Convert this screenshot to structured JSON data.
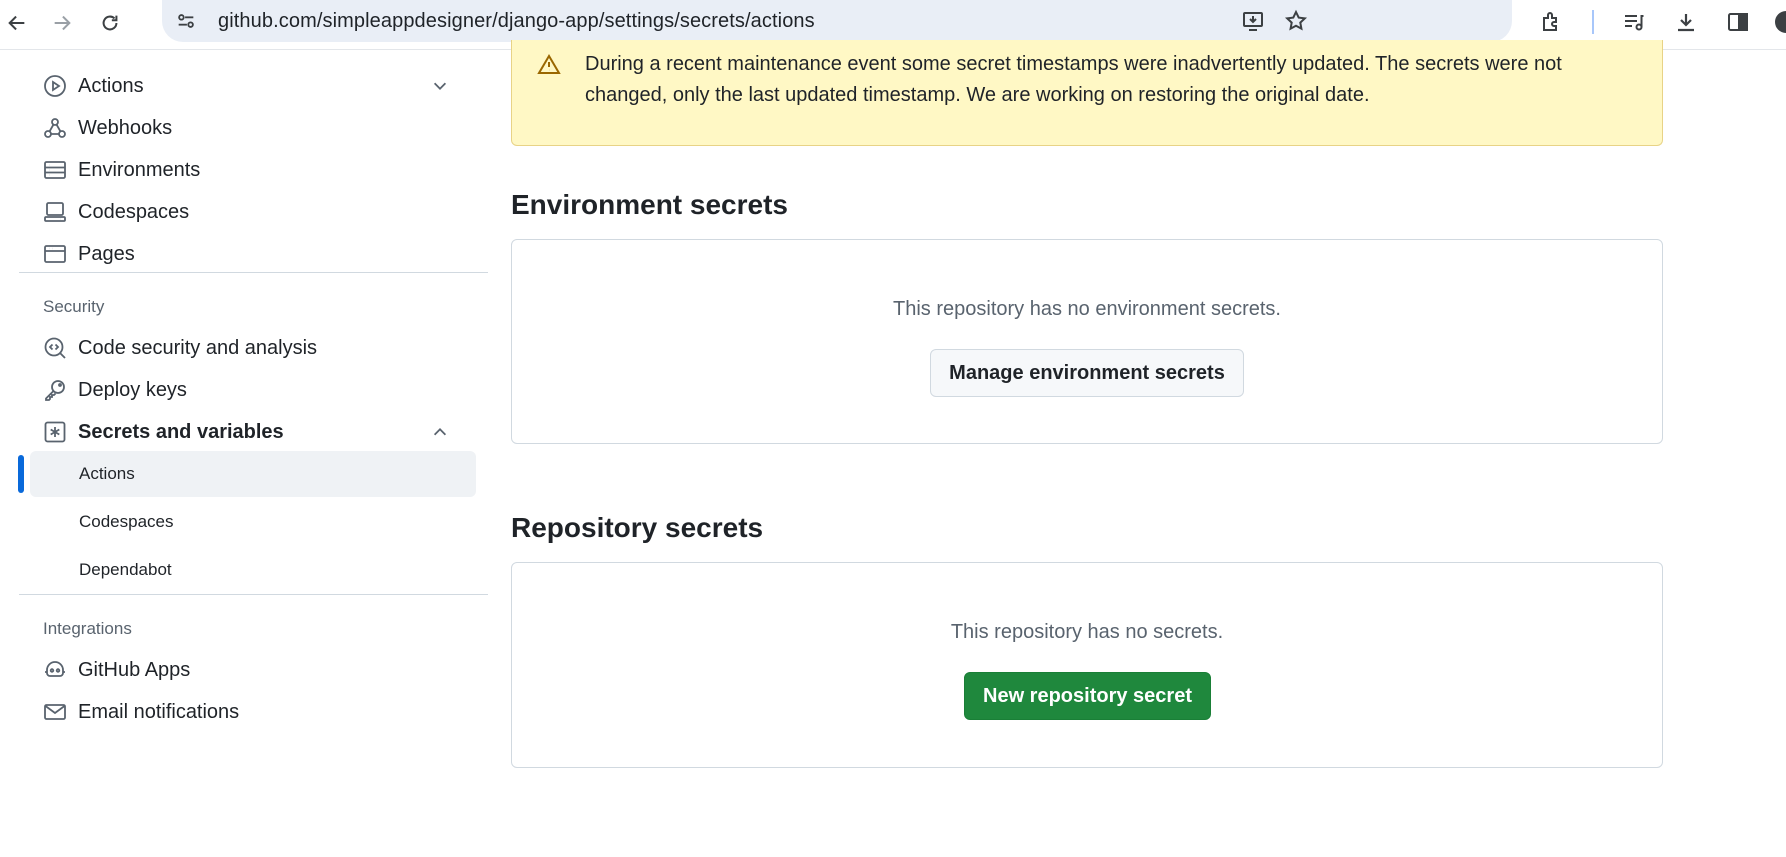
{
  "browser": {
    "url": "github.com/simpleappdesigner/django-app/settings/secrets/actions"
  },
  "sidebar": {
    "items": [
      {
        "label": "Actions",
        "icon": "play-icon",
        "expandable": true
      },
      {
        "label": "Webhooks",
        "icon": "webhook-icon"
      },
      {
        "label": "Environments",
        "icon": "server-icon"
      },
      {
        "label": "Codespaces",
        "icon": "codespaces-icon"
      },
      {
        "label": "Pages",
        "icon": "browser-icon"
      }
    ],
    "security_heading": "Security",
    "security_items": [
      {
        "label": "Code security and analysis",
        "icon": "codescan-icon"
      },
      {
        "label": "Deploy keys",
        "icon": "key-icon"
      },
      {
        "label": "Secrets and variables",
        "icon": "asterisk-icon",
        "expanded": true
      }
    ],
    "sub_items": [
      {
        "label": "Actions",
        "active": true
      },
      {
        "label": "Codespaces"
      },
      {
        "label": "Dependabot"
      }
    ],
    "integrations_heading": "Integrations",
    "integration_items": [
      {
        "label": "GitHub Apps",
        "icon": "apps-icon"
      },
      {
        "label": "Email notifications",
        "icon": "mail-icon"
      }
    ]
  },
  "main": {
    "flash_text": "During a recent maintenance event some secret timestamps were inadvertently updated. The secrets were not changed, only the last updated timestamp. We are working on restoring the original date.",
    "environment": {
      "title": "Environment secrets",
      "empty_text": "This repository has no environment secrets.",
      "button_label": "Manage environment secrets"
    },
    "repository": {
      "title": "Repository secrets",
      "empty_text": "This repository has no secrets.",
      "button_label": "New repository secret"
    }
  },
  "colors": {
    "accent": "#0969da",
    "primary_button": "#1f883d",
    "flash_bg": "#fff8c5"
  }
}
